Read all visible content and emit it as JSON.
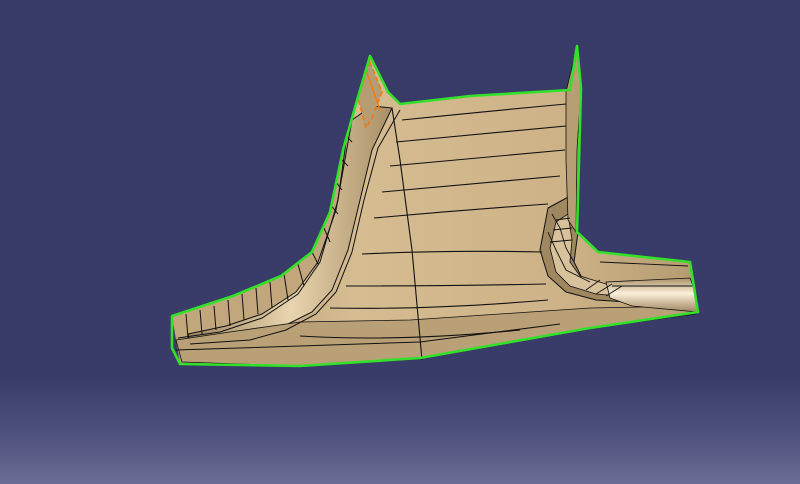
{
  "viewport": {
    "background_top": "#383a67",
    "background_bottom": "#6b6d95"
  },
  "model": {
    "surface_color": "#cdb287",
    "surface_shade": "#a98f66",
    "surface_highlight": "#e7d3ad",
    "edge_color": "#111111",
    "boundary_color": "#33e02a",
    "selected_face_color": "#f07b12"
  }
}
